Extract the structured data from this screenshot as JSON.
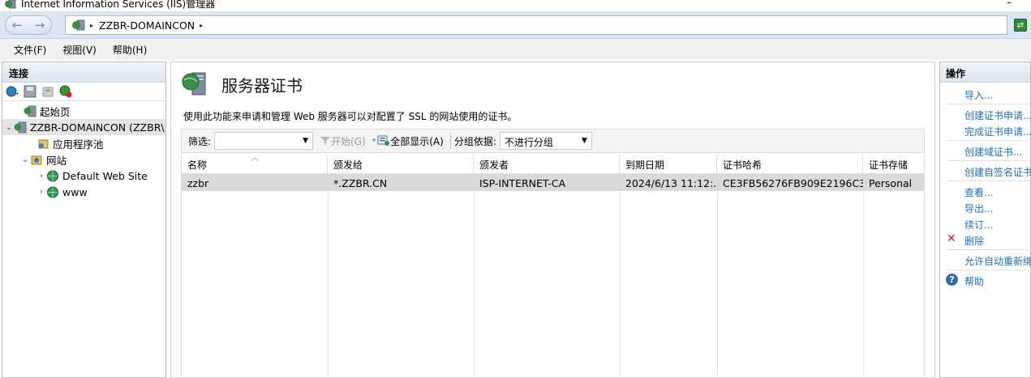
{
  "window": {
    "title": "Internet Information Services (IIS)管理器",
    "minimize_glyph": "–"
  },
  "address": {
    "crumbs": [
      "ZZBR-DOMAINCON"
    ],
    "separator": "▸"
  },
  "menu": [
    "文件(F)",
    "视图(V)",
    "帮助(H)"
  ],
  "connections": {
    "header": "连接",
    "tree": [
      {
        "label": "起始页",
        "level": 0,
        "expander": ""
      },
      {
        "label": "ZZBR-DOMAINCON (ZZBR\\",
        "level": 0,
        "expander": "⌄",
        "selected": true
      },
      {
        "label": "应用程序池",
        "level": 1,
        "expander": ""
      },
      {
        "label": "网站",
        "level": 1,
        "expander": "⌄"
      },
      {
        "label": "Default Web Site",
        "level": 2,
        "expander": "›"
      },
      {
        "label": "www",
        "level": 2,
        "expander": "›"
      }
    ]
  },
  "page": {
    "title": "服务器证书",
    "description": "使用此功能来申请和管理 Web 服务器可以对配置了 SSL 的网站使用的证书。",
    "filter": {
      "label": "筛选:",
      "value": "",
      "start_label": "开始(G)",
      "show_all_label": "全部显示(A)",
      "group_label": "分组依据:",
      "group_value": "不进行分组"
    },
    "columns": [
      "名称",
      "颁发给",
      "颁发者",
      "到期日期",
      "证书哈希",
      "证书存储"
    ],
    "rows": [
      [
        "zzbr",
        "*.ZZBR.CN",
        "ISP-INTERNET-CA",
        "2024/6/13 11:12:...",
        "CE3FB56276FB909E2196C3...",
        "Personal"
      ]
    ]
  },
  "actions": {
    "header": "操作",
    "import": "导入...",
    "create_request": "创建证书申请...",
    "complete_request": "完成证书申请...",
    "create_domain": "创建域证书...",
    "create_self_signed": "创建自签名证书",
    "view": "查看...",
    "export": "导出...",
    "renew": "续订...",
    "remove": "删除",
    "allow_auto_renew": "允许自动重新绑",
    "help": "帮助"
  },
  "colors": {
    "link": "#1d6fb8",
    "selected_row": "#d9d9d9",
    "header_bg": "#dde5f0"
  }
}
